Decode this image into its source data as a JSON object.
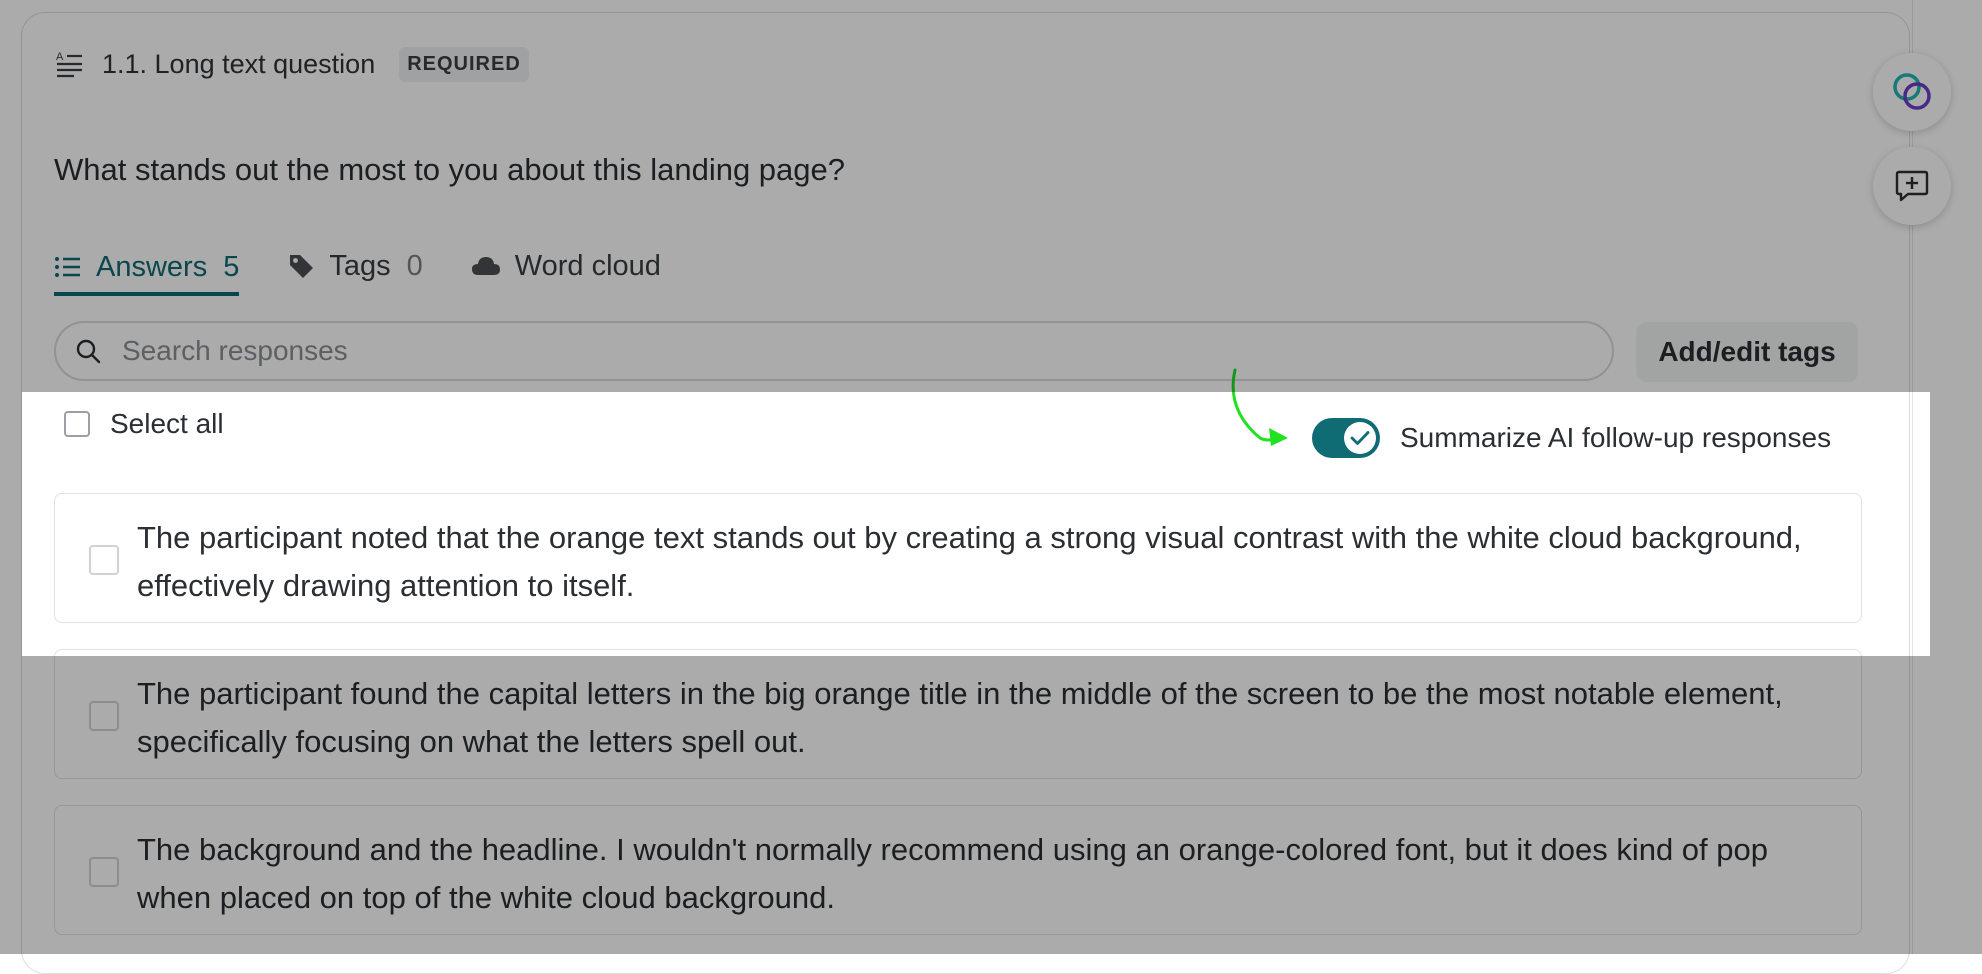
{
  "question": {
    "title": "1.1. Long text question",
    "badge": "REQUIRED",
    "text": "What stands out the most to you about this landing page?",
    "icon": "long-text-icon"
  },
  "tabs": [
    {
      "label": "Answers",
      "count": "5",
      "icon": "list-icon",
      "active": true
    },
    {
      "label": "Tags",
      "count": "0",
      "icon": "tag-icon",
      "active": false
    },
    {
      "label": "Word cloud",
      "icon": "cloud-icon",
      "active": false
    }
  ],
  "search": {
    "placeholder": "Search responses",
    "icon": "search-icon"
  },
  "add_edit_tags": "Add/edit tags",
  "select_all": "Select all",
  "summarize_toggle": {
    "label": "Summarize AI follow-up responses",
    "on": true
  },
  "answers": [
    "The participant noted that the orange text stands out by creating a strong visual contrast with the white cloud background, effectively drawing attention to itself.",
    "The participant found the capital letters in the big orange title in the middle of the screen to be the most notable element, specifically focusing on what the letters spell out.",
    "The background and the headline. I wouldn't normally recommend using an orange-colored font, but it does kind of pop when placed on top of the white cloud background."
  ],
  "side_buttons": [
    {
      "icon": "ai-summary-icon"
    },
    {
      "icon": "add-comment-icon"
    }
  ],
  "colors": {
    "accent": "#0f6b74",
    "highlight_arrow": "#22e022"
  }
}
